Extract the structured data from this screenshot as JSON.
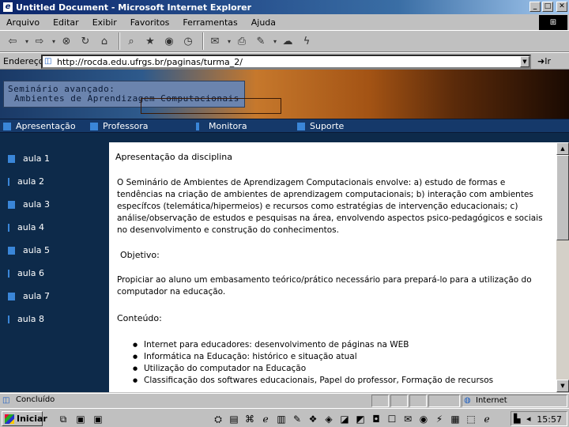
{
  "window": {
    "title": "Untitled Document - Microsoft Internet Explorer",
    "minimize": "_",
    "maximize": "□",
    "close": "✕"
  },
  "menu": [
    "Arquivo",
    "Editar",
    "Exibir",
    "Favoritos",
    "Ferramentas",
    "Ajuda"
  ],
  "address": {
    "label": "Endereço",
    "url": "http://rocda.edu.ufrgs.br/paginas/turma_2/",
    "go_label": "Ir"
  },
  "banner": {
    "line1": "Seminário avançado:",
    "line2": "Ambientes de Aprendizagem Computacionais"
  },
  "nav": [
    "Apresentação",
    "Professora",
    "Monitora",
    "Suporte"
  ],
  "sidebar": [
    "aula 1",
    "aula 2",
    "aula 3",
    "aula 4",
    "aula 5",
    "aula 6",
    "aula 7",
    "aula 8"
  ],
  "content": {
    "heading": "Apresentação da disciplina",
    "intro": "O Seminário de Ambientes de Aprendizagem Computacionais envolve: a) estudo de formas e tendências na criação de ambientes de aprendizagem computacionais; b) interação com ambientes específcos (telemática/hipermeios) e recursos como estratégias de intervenção educacionais; c) análise/observação de estudos e pesquisas na área, envolvendo aspectos psico-pedagógicos e sociais no desenvolvimento e construção do conhecimentos.",
    "objective_title": "Objetivo:",
    "objective_text": "Propiciar ao aluno um embasamento teórico/prático necessário para prepará-lo para a utilização do computador na educação.",
    "content_title": "Conteúdo:",
    "items": [
      "Internet para educadores: desenvolvimento de páginas na WEB",
      "Informática na Educação: histórico e situação atual",
      "Utilização do computador na Educação",
      "Classificação dos softwares educacionais, Papel do professor, Formação de recursos"
    ]
  },
  "status": {
    "text": "Concluído",
    "zone": "Internet"
  },
  "taskbar": {
    "start": "Iniciar",
    "clock": "15:57"
  }
}
